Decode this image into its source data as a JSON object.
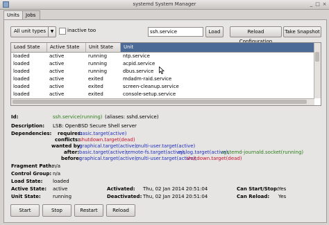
{
  "window": {
    "title": "systemd System Manager",
    "minimize": "_",
    "maximize": "□",
    "close": "×"
  },
  "tabs": [
    {
      "label": "Units"
    },
    {
      "label": "Jobs"
    }
  ],
  "toolbar": {
    "filter_value": "All unit types",
    "inactive_label": "inactive too",
    "search_value": "ssh.service",
    "load_label": "Load",
    "reload_config_label": "Reload Configuration",
    "snapshot_label": "Take Snapshot"
  },
  "table": {
    "columns": [
      "Load State",
      "Active State",
      "Unit State",
      "Unit"
    ],
    "rows": [
      [
        "loaded",
        "active",
        "running",
        "ntp.service"
      ],
      [
        "loaded",
        "active",
        "running",
        "acpid.service"
      ],
      [
        "loaded",
        "active",
        "running",
        "dbus.service"
      ],
      [
        "loaded",
        "active",
        "exited",
        "mdadm-raid.service"
      ],
      [
        "loaded",
        "active",
        "exited",
        "screen-cleanup.service"
      ],
      [
        "loaded",
        "active",
        "exited",
        "console-setup.service"
      ]
    ]
  },
  "details": {
    "id_label": "Id:",
    "id_value": "ssh.service(running)",
    "id_aliases": "(aliases: sshd.service)",
    "desc_label": "Description:",
    "desc_value": "LSB: OpenBSD Secure Shell server",
    "deps_label": "Dependencies:",
    "requires_label": "requires:",
    "requires_value": "basic.target(active)",
    "conflicts_label": "conflicts:",
    "conflicts_value": "shutdown.target(dead)",
    "wantedby_label": "wanted by:",
    "wantedby_1": "graphical.target(active),",
    "wantedby_2": "multi-user.target(active)",
    "after_label": "after:",
    "after_1": "basic.target(active),",
    "after_2": "remote-fs.target(active),",
    "after_3": "syslog.target(active),",
    "after_4": "systemd-journald.socket(running)",
    "before_label": "before:",
    "before_1": "graphical.target(active),",
    "before_2": "multi-user.target(active),",
    "before_3": "shutdown.target(dead)",
    "fragment_label": "Fragment Path:",
    "fragment_value": "n/a",
    "cgroup_label": "Control Group:",
    "cgroup_value": "n/a",
    "load_label": "Load State:",
    "load_value": "loaded",
    "active_label": "Active State:",
    "active_value": "active",
    "unit_label": "Unit State:",
    "unit_value": "running",
    "activated_label": "Activated:",
    "activated_value": "Thu, 02 Jan 2014 20:51:04",
    "deactivated_label": "Deactivated:",
    "deactivated_value": "Thu, 02 Jan 2014 20:51:04",
    "canstart_label": "Can Start/Stop:",
    "canstart_value": "Yes",
    "canreload_label": "Can Reload:",
    "canreload_value": "Yes"
  },
  "actions": {
    "start": "Start",
    "stop": "Stop",
    "restart": "Restart",
    "reload": "Reload"
  },
  "colors": {
    "selected_header": "#4c6a96",
    "ok": "#2a7d1a",
    "dead": "#c8102e",
    "link": "#1f2fbf"
  }
}
